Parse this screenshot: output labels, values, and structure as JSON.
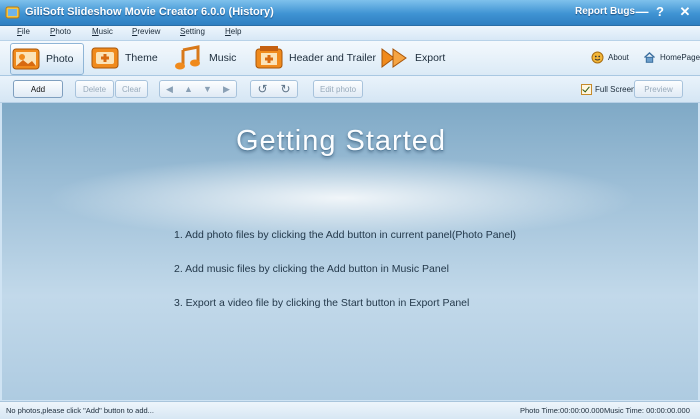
{
  "window": {
    "title": "GiliSoft Slideshow Movie Creator 6.0.0 (History)",
    "report_bugs": "Report Bugs",
    "help_glyph": "?",
    "minimize_glyph": "—",
    "close_glyph": "✕"
  },
  "menu": [
    "File",
    "Photo",
    "Music",
    "Preview",
    "Setting",
    "Help"
  ],
  "nav": {
    "items": [
      {
        "label": "Photo",
        "icon": "photo-icon",
        "active": true
      },
      {
        "label": "Theme",
        "icon": "theme-icon"
      },
      {
        "label": "Music",
        "icon": "music-icon"
      },
      {
        "label": "Header and Trailer",
        "icon": "header-trailer-icon"
      },
      {
        "label": "Export",
        "icon": "export-icon"
      }
    ],
    "about": "About",
    "homepage": "HomePage"
  },
  "toolbar": {
    "add": "Add",
    "delete": "Delete",
    "clear": "Clear",
    "edit_photo": "Edit photo",
    "full_screen": "Full Screen",
    "full_screen_checked": true,
    "preview": "Preview"
  },
  "content": {
    "heading": "Getting Started",
    "steps": [
      "1. Add photo files by clicking the Add button in current panel(Photo Panel)",
      "2. Add music files by clicking the Add button in Music Panel",
      "3. Export a video file by clicking the Start button in Export Panel"
    ]
  },
  "status": {
    "message": "No photos,please click \"Add\" button to add...",
    "photo_time": "Photo Time:00:00:00.000",
    "music_time": "Music Time: 00:00:00.000"
  },
  "colors": {
    "titlebar": "#3f93d3",
    "accent_orange": "#f08a1c",
    "content_bg": "#a9c8de"
  }
}
